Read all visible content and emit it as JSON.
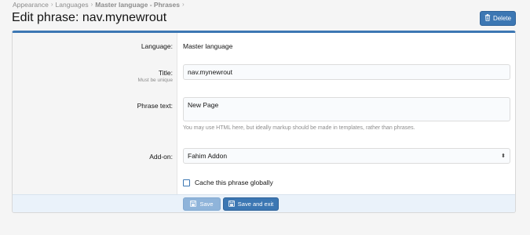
{
  "breadcrumb": {
    "items": [
      "Appearance",
      "Languages",
      "Master language - Phrases"
    ]
  },
  "page_title": "Edit phrase: nav.mynewrout",
  "delete_button": "Delete",
  "form": {
    "language": {
      "label": "Language:",
      "value": "Master language"
    },
    "title": {
      "label": "Title:",
      "hint": "Must be unique",
      "value": "nav.mynewrout"
    },
    "phrase_text": {
      "label": "Phrase text:",
      "value": "New Page",
      "explain": "You may use HTML here, but ideally markup should be made in templates, rather than phrases."
    },
    "addon": {
      "label": "Add-on:",
      "selected": "Fahim Addon"
    },
    "cache": {
      "label": "Cache this phrase globally",
      "checked": false
    }
  },
  "footer": {
    "save_label": "Save",
    "save_exit_label": "Save and exit"
  },
  "colors": {
    "accent": "#3c77b3",
    "save_disabled": "#8fb4da",
    "footer_bg": "#eaf2fa"
  },
  "icons": {
    "delete": "trash-icon",
    "save": "save-icon",
    "select": "chevron-updown-icon"
  }
}
